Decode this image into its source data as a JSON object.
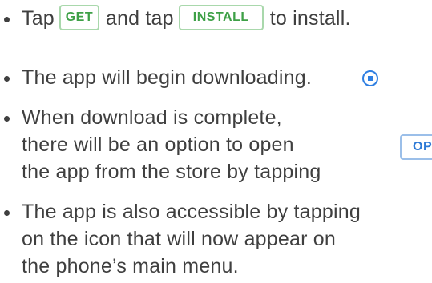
{
  "items": [
    {
      "before": "Tap",
      "get_label": "GET",
      "middle": "and tap",
      "install_label": "INSTALL",
      "after": "to install."
    },
    {
      "text": "The app will begin downloading.",
      "icon": "download-progress-icon"
    },
    {
      "lines": [
        "When download is complete,",
        "there will be an option to open",
        "the app from the store by tapping"
      ],
      "open_label": "OPEN"
    },
    {
      "lines": [
        "The app is also accessible by tapping",
        "on the icon that will now appear on",
        "the phone’s main menu."
      ]
    }
  ],
  "colors": {
    "text": "#3f3f3f",
    "green_button": "#3ea047",
    "green_border": "#a9d8ac",
    "blue_button": "#2e7ad6",
    "blue_border": "#9bbfe9"
  }
}
